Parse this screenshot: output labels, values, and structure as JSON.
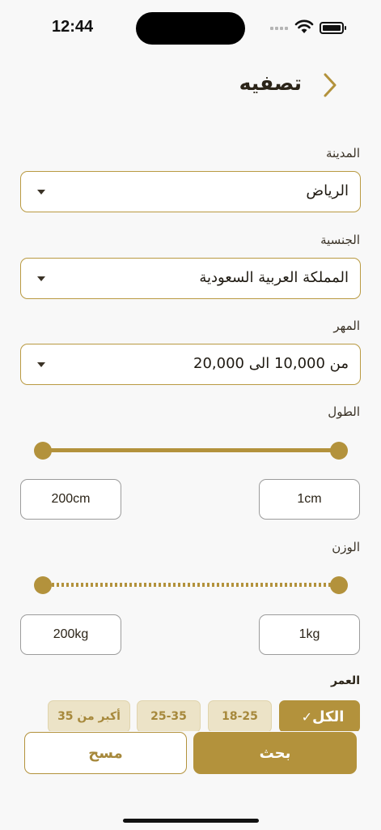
{
  "status_bar": {
    "time": "12:44"
  },
  "header": {
    "title": "تصفيه",
    "back_icon": "chevron-right-icon"
  },
  "filters": {
    "city": {
      "label": "المدينة",
      "value": "الرياض"
    },
    "nationality": {
      "label": "الجنسية",
      "value": "المملكة العربية السعودية"
    },
    "dowry": {
      "label": "المهر",
      "value": "من 10,000 الى 20,000"
    },
    "height": {
      "label": "الطول",
      "min": "1cm",
      "max": "200cm"
    },
    "weight": {
      "label": "الوزن",
      "min": "1kg",
      "max": "200kg"
    },
    "age": {
      "label": "العمر",
      "options": [
        "الكل",
        "18-25",
        "25-35",
        "أكبر من 35"
      ],
      "selected": "الكل"
    }
  },
  "actions": {
    "search": "بحث",
    "clear": "مسح"
  },
  "colors": {
    "accent": "#b3923c",
    "chip_bg": "#ece3c7",
    "background": "#f8f8f8"
  }
}
